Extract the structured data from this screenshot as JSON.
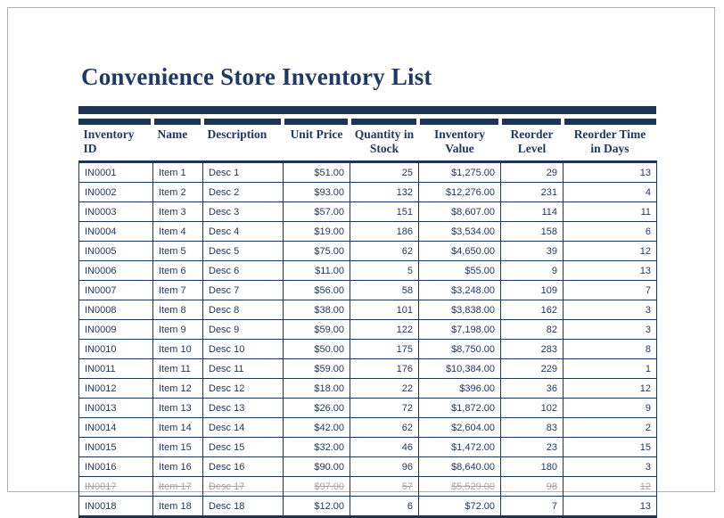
{
  "document": {
    "title": "Convenience Store Inventory List",
    "accent_color": "#1c3557",
    "text_color": "#1f3864",
    "struck_color": "#a6a6a6",
    "page_background": "#ffffff"
  },
  "table": {
    "columns": [
      {
        "label": "Inventory ID",
        "align": "left"
      },
      {
        "label": "Name",
        "align": "left"
      },
      {
        "label": "Description",
        "align": "left"
      },
      {
        "label": "Unit Price",
        "align": "right"
      },
      {
        "label": "Quantity in Stock",
        "align": "right"
      },
      {
        "label": "Inventory Value",
        "align": "right"
      },
      {
        "label": "Reorder Level",
        "align": "right"
      },
      {
        "label": "Reorder Time in Days",
        "align": "right"
      }
    ],
    "rows": [
      {
        "inventory_id": "IN0001",
        "name": "Item 1",
        "description": "Desc 1",
        "unit_price": "$51.00",
        "quantity_in_stock": "25",
        "inventory_value": "$1,275.00",
        "reorder_level": "29",
        "reorder_time_in_days": "13",
        "struck": false
      },
      {
        "inventory_id": "IN0002",
        "name": "Item 2",
        "description": "Desc 2",
        "unit_price": "$93.00",
        "quantity_in_stock": "132",
        "inventory_value": "$12,276.00",
        "reorder_level": "231",
        "reorder_time_in_days": "4",
        "struck": false
      },
      {
        "inventory_id": "IN0003",
        "name": "Item 3",
        "description": "Desc 3",
        "unit_price": "$57.00",
        "quantity_in_stock": "151",
        "inventory_value": "$8,607.00",
        "reorder_level": "114",
        "reorder_time_in_days": "11",
        "struck": false
      },
      {
        "inventory_id": "IN0004",
        "name": "Item 4",
        "description": "Desc 4",
        "unit_price": "$19.00",
        "quantity_in_stock": "186",
        "inventory_value": "$3,534.00",
        "reorder_level": "158",
        "reorder_time_in_days": "6",
        "struck": false
      },
      {
        "inventory_id": "IN0005",
        "name": "Item 5",
        "description": "Desc 5",
        "unit_price": "$75.00",
        "quantity_in_stock": "62",
        "inventory_value": "$4,650.00",
        "reorder_level": "39",
        "reorder_time_in_days": "12",
        "struck": false
      },
      {
        "inventory_id": "IN0006",
        "name": "Item 6",
        "description": "Desc 6",
        "unit_price": "$11.00",
        "quantity_in_stock": "5",
        "inventory_value": "$55.00",
        "reorder_level": "9",
        "reorder_time_in_days": "13",
        "struck": false
      },
      {
        "inventory_id": "IN0007",
        "name": "Item 7",
        "description": "Desc 7",
        "unit_price": "$56.00",
        "quantity_in_stock": "58",
        "inventory_value": "$3,248.00",
        "reorder_level": "109",
        "reorder_time_in_days": "7",
        "struck": false
      },
      {
        "inventory_id": "IN0008",
        "name": "Item 8",
        "description": "Desc 8",
        "unit_price": "$38.00",
        "quantity_in_stock": "101",
        "inventory_value": "$3,838.00",
        "reorder_level": "162",
        "reorder_time_in_days": "3",
        "struck": false
      },
      {
        "inventory_id": "IN0009",
        "name": "Item 9",
        "description": "Desc 9",
        "unit_price": "$59.00",
        "quantity_in_stock": "122",
        "inventory_value": "$7,198.00",
        "reorder_level": "82",
        "reorder_time_in_days": "3",
        "struck": false
      },
      {
        "inventory_id": "IN0010",
        "name": "Item 10",
        "description": "Desc 10",
        "unit_price": "$50.00",
        "quantity_in_stock": "175",
        "inventory_value": "$8,750.00",
        "reorder_level": "283",
        "reorder_time_in_days": "8",
        "struck": false
      },
      {
        "inventory_id": "IN0011",
        "name": "Item 11",
        "description": "Desc 11",
        "unit_price": "$59.00",
        "quantity_in_stock": "176",
        "inventory_value": "$10,384.00",
        "reorder_level": "229",
        "reorder_time_in_days": "1",
        "struck": false
      },
      {
        "inventory_id": "IN0012",
        "name": "Item 12",
        "description": "Desc 12",
        "unit_price": "$18.00",
        "quantity_in_stock": "22",
        "inventory_value": "$396.00",
        "reorder_level": "36",
        "reorder_time_in_days": "12",
        "struck": false
      },
      {
        "inventory_id": "IN0013",
        "name": "Item 13",
        "description": "Desc 13",
        "unit_price": "$26.00",
        "quantity_in_stock": "72",
        "inventory_value": "$1,872.00",
        "reorder_level": "102",
        "reorder_time_in_days": "9",
        "struck": false
      },
      {
        "inventory_id": "IN0014",
        "name": "Item 14",
        "description": "Desc 14",
        "unit_price": "$42.00",
        "quantity_in_stock": "62",
        "inventory_value": "$2,604.00",
        "reorder_level": "83",
        "reorder_time_in_days": "2",
        "struck": false
      },
      {
        "inventory_id": "IN0015",
        "name": "Item 15",
        "description": "Desc 15",
        "unit_price": "$32.00",
        "quantity_in_stock": "46",
        "inventory_value": "$1,472.00",
        "reorder_level": "23",
        "reorder_time_in_days": "15",
        "struck": false
      },
      {
        "inventory_id": "IN0016",
        "name": "Item 16",
        "description": "Desc 16",
        "unit_price": "$90.00",
        "quantity_in_stock": "96",
        "inventory_value": "$8,640.00",
        "reorder_level": "180",
        "reorder_time_in_days": "3",
        "struck": false
      },
      {
        "inventory_id": "IN0017",
        "name": "Item 17",
        "description": "Desc 17",
        "unit_price": "$97.00",
        "quantity_in_stock": "57",
        "inventory_value": "$5,529.00",
        "reorder_level": "98",
        "reorder_time_in_days": "12",
        "struck": true
      },
      {
        "inventory_id": "IN0018",
        "name": "Item 18",
        "description": "Desc 18",
        "unit_price": "$12.00",
        "quantity_in_stock": "6",
        "inventory_value": "$72.00",
        "reorder_level": "7",
        "reorder_time_in_days": "13",
        "struck": false
      }
    ]
  }
}
